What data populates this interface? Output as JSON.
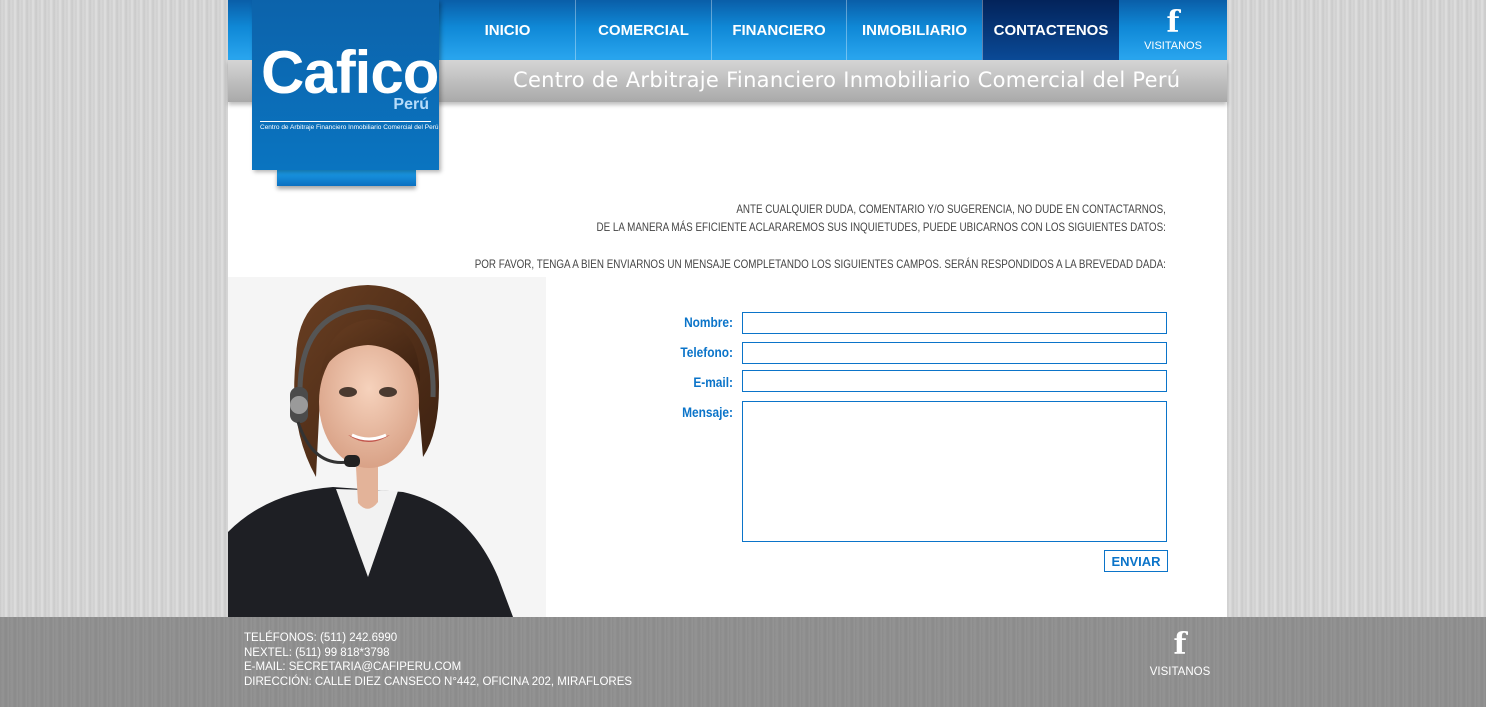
{
  "brand": {
    "name": "Cafico",
    "country": "Perú",
    "full_name": "Centro de Arbitraje Financiero Inmobiliario Comercial del Perú",
    "tagline": "Centro de Arbitraje Financiero Inmobiliario Comercial del Perú"
  },
  "nav": {
    "items": [
      {
        "label": "INICIO",
        "active": false
      },
      {
        "label": "COMERCIAL",
        "active": false
      },
      {
        "label": "FINANCIERO",
        "active": false
      },
      {
        "label": "INMOBILIARIO",
        "active": false
      },
      {
        "label": "CONTACTENOS",
        "active": true
      }
    ],
    "facebook_label": "VISITANOS",
    "facebook_icon": "facebook-icon"
  },
  "intro": {
    "line1": "ANTE CUALQUIER DUDA, COMENTARIO Y/O SUGERENCIA, NO DUDE EN CONTACTARNOS,",
    "line2": "DE LA MANERA MÁS EFICIENTE ACLARAREMOS SUS INQUIETUDES, PUEDE UBICARNOS CON LOS SIGUIENTES DATOS:",
    "line3": "POR FAVOR, TENGA A BIEN ENVIARNOS UN MENSAJE COMPLETANDO LOS SIGUIENTES CAMPOS. SERÁN RESPONDIDOS A LA BREVEDAD DADA:"
  },
  "form": {
    "name_label": "Nombre:",
    "name_value": "",
    "phone_label": "Telefono:",
    "phone_value": "",
    "email_label": "E-mail:",
    "email_value": "",
    "message_label": "Mensaje:",
    "message_value": "",
    "submit_label": "ENVIAR"
  },
  "footer": {
    "phones": "TELÉFONOS:  (511) 242.6990",
    "nextel": "NEXTEL: (511) 99 818*3798",
    "email": "E-MAIL: SECRETARIA@CAFIPERU.COM",
    "address": "DIRECCIÓN: CALLE DIEZ CANSECO N°442, OFICINA 202, MIRAFLORES",
    "facebook_label": "VISITANOS"
  },
  "colors": {
    "brand_blue": "#0b74c9",
    "nav_active": "#03235a"
  }
}
